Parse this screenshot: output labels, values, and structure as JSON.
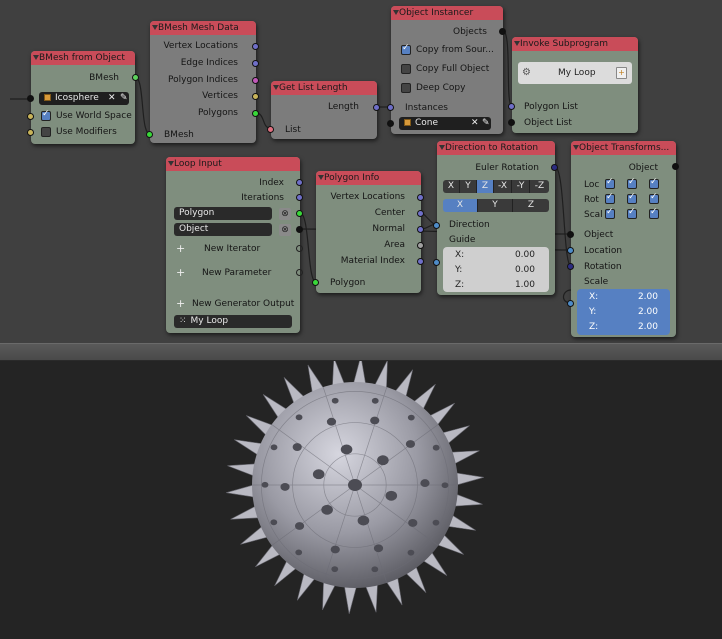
{
  "nodes": {
    "bmesh_from_object": {
      "title": "BMesh from Object",
      "out_bmesh": "BMesh",
      "object_value": "Icosphere",
      "use_world_space": "Use World Space",
      "use_modifiers": "Use Modifiers"
    },
    "bmesh_mesh_data": {
      "title": "BMesh Mesh Data",
      "outputs": [
        "Vertex Locations",
        "Edge Indices",
        "Polygon Indices",
        "Vertices",
        "Polygons"
      ],
      "in_bmesh": "BMesh"
    },
    "get_list_length": {
      "title": "Get List Length",
      "out_length": "Length",
      "in_list": "List"
    },
    "object_instancer": {
      "title": "Object Instancer",
      "out_objects": "Objects",
      "copy_from_source": "Copy from Sour...",
      "copy_full_object": "Copy Full Object",
      "deep_copy": "Deep Copy",
      "in_instances": "Instances",
      "object_value": "Cone"
    },
    "invoke_subprogram": {
      "title": "Invoke Subprogram",
      "subprogram": "My Loop",
      "out_polygon_list": "Polygon List",
      "out_object_list": "Object List"
    },
    "loop_input": {
      "title": "Loop Input",
      "out_index": "Index",
      "out_iterations": "Iterations",
      "param_polygon": "Polygon",
      "param_object": "Object",
      "new_iterator": "New Iterator",
      "new_parameter": "New Parameter",
      "new_generator_output": "New Generator Output",
      "loop_name": "My Loop"
    },
    "polygon_info": {
      "title": "Polygon Info",
      "outputs": [
        "Vertex Locations",
        "Center",
        "Normal",
        "Area",
        "Material Index"
      ],
      "in_polygon": "Polygon"
    },
    "direction_to_rotation": {
      "title": "Direction to Rotation",
      "out_euler": "Euler Rotation",
      "track_axes": [
        "X",
        "Y",
        "Z",
        "-X",
        "-Y",
        "-Z"
      ],
      "up_axes": [
        "X",
        "Y",
        "Z"
      ],
      "in_direction": "Direction",
      "in_guide": "Guide",
      "guide_x_label": "X:",
      "guide_x": "0.00",
      "guide_y_label": "Y:",
      "guide_y": "0.00",
      "guide_z_label": "Z:",
      "guide_z": "1.00"
    },
    "object_transforms": {
      "title": "Object Transforms...",
      "out_object": "Object",
      "loc": "Loc",
      "rot": "Rot",
      "scal": "Scal",
      "in_object": "Object",
      "in_location": "Location",
      "in_rotation": "Rotation",
      "in_scale": "Scale",
      "scale_x_label": "X:",
      "scale_x": "2.00",
      "scale_y_label": "Y:",
      "scale_y": "2.00",
      "scale_z_label": "Z:",
      "scale_z": "2.00"
    }
  },
  "colors": {
    "header": "#c94c59",
    "node_green": "#7f8e7e",
    "node_grey": "#7c7c7c",
    "editor_bg": "#404040",
    "viewport_bg": "#242424",
    "accent": "#5680c2"
  }
}
